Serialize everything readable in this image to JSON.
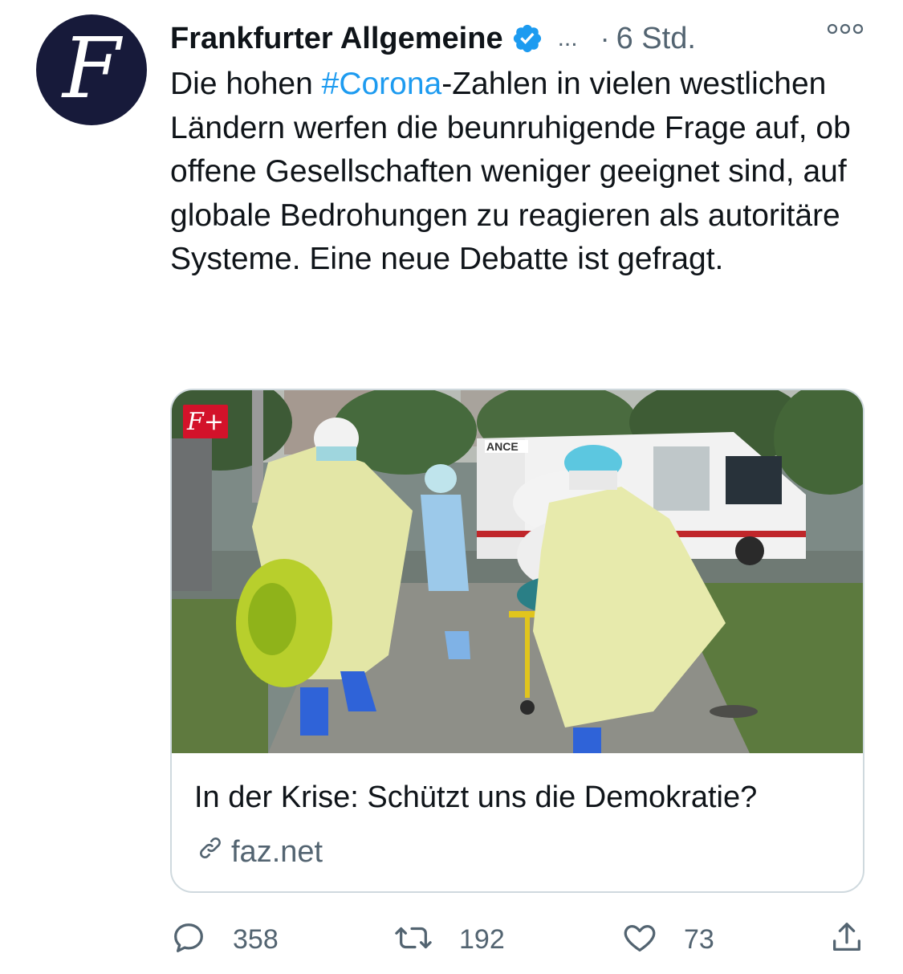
{
  "account": {
    "avatar_letter": "F",
    "name": "Frankfurter Allgemeine",
    "verified_icon": "verified-badge-icon",
    "ellipsis": "...",
    "time_separator": "·",
    "time": "6 Std.",
    "more_icon": "more-options-icon"
  },
  "tweet": {
    "text_before": "Die hohen ",
    "hashtag": "#Corona",
    "text_after": "-Zahlen in vielen westlichen Ländern werfen die beunruhigende Frage auf, ob offene Gesellschaften weniger geeignet sind, auf globale Bedrohungen zu reagieren als autoritäre Systeme. Eine neue Debatte ist gefragt."
  },
  "card": {
    "badge": "F+",
    "ambulance_sign": "ANCE",
    "title": "In der Krise: Schützt uns die Demokratie?",
    "domain": "faz.net"
  },
  "actions": {
    "reply_count": "358",
    "retweet_count": "192",
    "like_count": "73"
  },
  "colors": {
    "accent": "#1d9bf0",
    "muted": "#536471",
    "avatar_bg": "#171a3a",
    "badge_red": "#d3122a"
  }
}
